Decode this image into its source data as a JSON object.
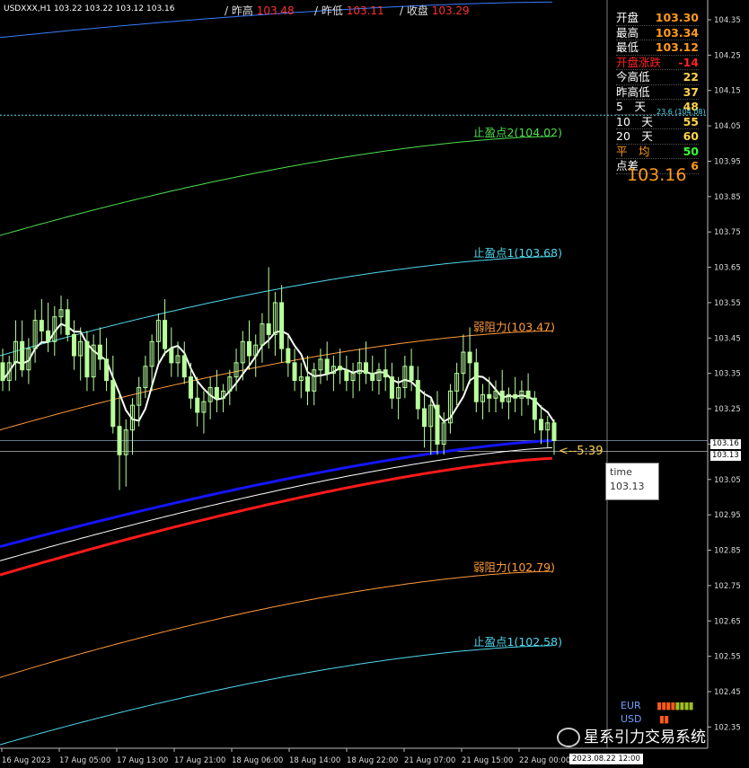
{
  "symbol_header": "USDXXX,H1  103.22 103.22 103.12 103.16",
  "top": [
    {
      "label": "/ 昨高",
      "value": "103.48"
    },
    {
      "label": "/ 昨低",
      "value": "103.11"
    },
    {
      "label": "/ 收盘",
      "value": "103.29"
    }
  ],
  "panel": [
    {
      "k": "开盘",
      "v": "103.30",
      "c": "#ff9a1a",
      "kc": "#fff"
    },
    {
      "k": "最高",
      "v": "103.34",
      "c": "#ff9a1a",
      "kc": "#fff"
    },
    {
      "k": "最低",
      "v": "103.12",
      "c": "#ff9a1a",
      "kc": "#fff"
    },
    {
      "k": "开盘涨跌",
      "v": "-14",
      "c": "#ff2222",
      "kc": "#ff2222"
    },
    {
      "k": "今高低",
      "v": "22",
      "c": "#ffd24a",
      "kc": "#fff"
    },
    {
      "k": "昨高低",
      "v": "37",
      "c": "#ffd24a",
      "kc": "#fff"
    },
    {
      "k": "5　天",
      "v": "48",
      "c": "#ffd24a",
      "kc": "#fff"
    },
    {
      "k": "10　天",
      "v": "55",
      "c": "#ffd24a",
      "kc": "#fff"
    },
    {
      "k": "20　天",
      "v": "60",
      "c": "#ffd24a",
      "kc": "#fff"
    },
    {
      "k": "平　均",
      "v": "50",
      "c": "#33ff33",
      "kc": "#ff9a1a"
    },
    {
      "k": "点差",
      "v": "6",
      "c": "#ff9a1a",
      "kc": "#fff"
    }
  ],
  "big_price": "103.16",
  "fib_label": "23.6 (104.08)",
  "countdown": "<--5:39",
  "tooltip": {
    "title": "time",
    "value": "103.13"
  },
  "price_tags": {
    "bid": "103.16",
    "ask": "103.13"
  },
  "legend": [
    "EUR",
    "USD"
  ],
  "watermark": "星系引力交易系统",
  "colors": {
    "bull": "#b8ff9a",
    "ma_white": "#ffffff",
    "ma_blue": "#1515ff",
    "ma_red": "#ff1a1a",
    "tp_cyan": "#4fd8ee",
    "tp_green": "#4ce04c",
    "resist_orange": "#ff9a3a",
    "down": "#ff3030"
  },
  "chart_data": {
    "type": "candlestick",
    "y_ticks": [
      "104.35",
      "104.25",
      "104.15",
      "104.05",
      "103.95",
      "103.85",
      "103.75",
      "103.65",
      "103.55",
      "103.45",
      "103.35",
      "103.25",
      "103.15",
      "103.05",
      "102.95",
      "102.85",
      "102.75",
      "102.65",
      "102.55",
      "102.45",
      "102.35"
    ],
    "ylim": [
      102.3,
      104.4
    ],
    "x_ticks": [
      "16 Aug 2023",
      "17 Aug 05:00",
      "17 Aug 13:00",
      "17 Aug 21:00",
      "18 Aug 06:00",
      "18 Aug 14:00",
      "18 Aug 22:00",
      "21 Aug 07:00",
      "21 Aug 15:00",
      "22 Aug 00:00"
    ],
    "cursor_time": "2023.08.22 12:00",
    "levels": [
      {
        "name": "止盈点2",
        "value": 104.02,
        "label": "止盈点2(104.02)",
        "color": "tp_green"
      },
      {
        "name": "止盈点1",
        "value": 103.68,
        "label": "止盈点1(103.68)",
        "color": "tp_cyan"
      },
      {
        "name": "弱阻力",
        "value": 103.47,
        "label": "弱阻力(103.47)",
        "color": "resist_orange"
      },
      {
        "name": "弱阻力",
        "value": 102.79,
        "label": "弱阻力(102.79)",
        "color": "resist_orange"
      },
      {
        "name": "止盈点1",
        "value": 102.58,
        "label": "止盈点1(102.58)",
        "color": "tp_cyan"
      }
    ],
    "fib_level": 104.08,
    "bid": 103.16,
    "ask": 103.13,
    "candles": [
      [
        103.38,
        103.42,
        103.3,
        103.33
      ],
      [
        103.33,
        103.4,
        103.3,
        103.38
      ],
      [
        103.38,
        103.5,
        103.33,
        103.44
      ],
      [
        103.44,
        103.5,
        103.34,
        103.36
      ],
      [
        103.36,
        103.45,
        103.32,
        103.42
      ],
      [
        103.42,
        103.53,
        103.38,
        103.5
      ],
      [
        103.5,
        103.56,
        103.44,
        103.47
      ],
      [
        103.47,
        103.55,
        103.41,
        103.44
      ],
      [
        103.44,
        103.54,
        103.4,
        103.51
      ],
      [
        103.51,
        103.57,
        103.46,
        103.53
      ],
      [
        103.53,
        103.56,
        103.44,
        103.46
      ],
      [
        103.46,
        103.5,
        103.36,
        103.4
      ],
      [
        103.4,
        103.48,
        103.33,
        103.44
      ],
      [
        103.44,
        103.47,
        103.3,
        103.34
      ],
      [
        103.34,
        103.46,
        103.3,
        103.43
      ],
      [
        103.43,
        103.48,
        103.36,
        103.39
      ],
      [
        103.39,
        103.45,
        103.3,
        103.33
      ],
      [
        103.33,
        103.4,
        103.18,
        103.2
      ],
      [
        103.2,
        103.3,
        103.02,
        103.12
      ],
      [
        103.12,
        103.22,
        103.03,
        103.19
      ],
      [
        103.19,
        103.28,
        103.12,
        103.26
      ],
      [
        103.26,
        103.34,
        103.2,
        103.31
      ],
      [
        103.31,
        103.4,
        103.28,
        103.37
      ],
      [
        103.37,
        103.46,
        103.3,
        103.44
      ],
      [
        103.44,
        103.52,
        103.38,
        103.5
      ],
      [
        103.5,
        103.56,
        103.4,
        103.42
      ],
      [
        103.42,
        103.48,
        103.34,
        103.38
      ],
      [
        103.38,
        103.44,
        103.34,
        103.4
      ],
      [
        103.4,
        103.44,
        103.32,
        103.34
      ],
      [
        103.34,
        103.38,
        103.25,
        103.28
      ],
      [
        103.28,
        103.34,
        103.2,
        103.24
      ],
      [
        103.24,
        103.3,
        103.18,
        103.27
      ],
      [
        103.27,
        103.34,
        103.22,
        103.31
      ],
      [
        103.31,
        103.36,
        103.24,
        103.28
      ],
      [
        103.28,
        103.32,
        103.24,
        103.3
      ],
      [
        103.3,
        103.36,
        103.26,
        103.34
      ],
      [
        103.34,
        103.42,
        103.3,
        103.38
      ],
      [
        103.38,
        103.47,
        103.33,
        103.44
      ],
      [
        103.44,
        103.5,
        103.36,
        103.4
      ],
      [
        103.4,
        103.46,
        103.34,
        103.43
      ],
      [
        103.43,
        103.52,
        103.38,
        103.49
      ],
      [
        103.49,
        103.65,
        103.42,
        103.46
      ],
      [
        103.46,
        103.58,
        103.4,
        103.55
      ],
      [
        103.55,
        103.6,
        103.38,
        103.42
      ],
      [
        103.42,
        103.46,
        103.34,
        103.38
      ],
      [
        103.38,
        103.42,
        103.3,
        103.33
      ],
      [
        103.33,
        103.38,
        103.28,
        103.34
      ],
      [
        103.34,
        103.4,
        103.26,
        103.3
      ],
      [
        103.3,
        103.38,
        103.26,
        103.36
      ],
      [
        103.36,
        103.42,
        103.32,
        103.39
      ],
      [
        103.39,
        103.44,
        103.33,
        103.35
      ],
      [
        103.35,
        103.4,
        103.3,
        103.37
      ],
      [
        103.37,
        103.42,
        103.32,
        103.36
      ],
      [
        103.36,
        103.4,
        103.3,
        103.33
      ],
      [
        103.33,
        103.38,
        103.28,
        103.35
      ],
      [
        103.35,
        103.42,
        103.3,
        103.38
      ],
      [
        103.38,
        103.44,
        103.32,
        103.35
      ],
      [
        103.35,
        103.4,
        103.3,
        103.33
      ],
      [
        103.33,
        103.38,
        103.29,
        103.36
      ],
      [
        103.36,
        103.42,
        103.3,
        103.34
      ],
      [
        103.34,
        103.38,
        103.25,
        103.28
      ],
      [
        103.28,
        103.34,
        103.22,
        103.31
      ],
      [
        103.31,
        103.4,
        103.28,
        103.37
      ],
      [
        103.37,
        103.42,
        103.3,
        103.33
      ],
      [
        103.33,
        103.37,
        103.22,
        103.25
      ],
      [
        103.25,
        103.3,
        103.14,
        103.2
      ],
      [
        103.2,
        103.28,
        103.12,
        103.26
      ],
      [
        103.26,
        103.3,
        103.12,
        103.15
      ],
      [
        103.15,
        103.24,
        103.12,
        103.21
      ],
      [
        103.21,
        103.32,
        103.18,
        103.3
      ],
      [
        103.3,
        103.38,
        103.26,
        103.35
      ],
      [
        103.35,
        103.46,
        103.3,
        103.41
      ],
      [
        103.41,
        103.48,
        103.32,
        103.38
      ],
      [
        103.38,
        103.42,
        103.24,
        103.27
      ],
      [
        103.27,
        103.32,
        103.22,
        103.29
      ],
      [
        103.29,
        103.34,
        103.24,
        103.28
      ],
      [
        103.28,
        103.33,
        103.24,
        103.3
      ],
      [
        103.3,
        103.36,
        103.25,
        103.27
      ],
      [
        103.27,
        103.31,
        103.22,
        103.29
      ],
      [
        103.29,
        103.34,
        103.24,
        103.28
      ],
      [
        103.28,
        103.33,
        103.23,
        103.3
      ],
      [
        103.3,
        103.35,
        103.26,
        103.28
      ],
      [
        103.28,
        103.3,
        103.18,
        103.22
      ],
      [
        103.22,
        103.26,
        103.15,
        103.19
      ],
      [
        103.19,
        103.23,
        103.14,
        103.21
      ],
      [
        103.21,
        103.22,
        103.12,
        103.16
      ]
    ]
  }
}
